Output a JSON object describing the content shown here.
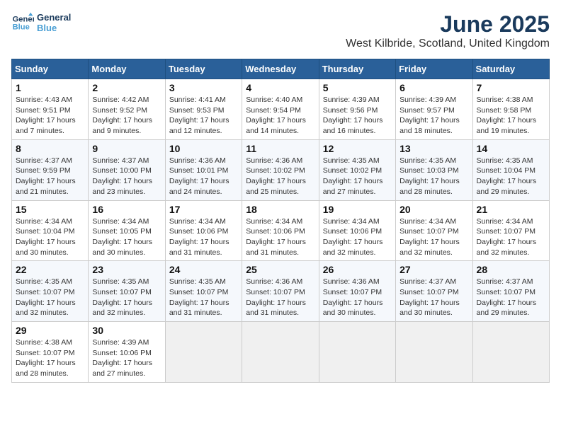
{
  "logo": {
    "line1": "General",
    "line2": "Blue"
  },
  "title": "June 2025",
  "subtitle": "West Kilbride, Scotland, United Kingdom",
  "colors": {
    "header_bg": "#2a6099",
    "accent": "#4a9fd4",
    "title_color": "#1a3a5c"
  },
  "days_of_week": [
    "Sunday",
    "Monday",
    "Tuesday",
    "Wednesday",
    "Thursday",
    "Friday",
    "Saturday"
  ],
  "weeks": [
    [
      {
        "day": "1",
        "detail": "Sunrise: 4:43 AM\nSunset: 9:51 PM\nDaylight: 17 hours\nand 7 minutes."
      },
      {
        "day": "2",
        "detail": "Sunrise: 4:42 AM\nSunset: 9:52 PM\nDaylight: 17 hours\nand 9 minutes."
      },
      {
        "day": "3",
        "detail": "Sunrise: 4:41 AM\nSunset: 9:53 PM\nDaylight: 17 hours\nand 12 minutes."
      },
      {
        "day": "4",
        "detail": "Sunrise: 4:40 AM\nSunset: 9:54 PM\nDaylight: 17 hours\nand 14 minutes."
      },
      {
        "day": "5",
        "detail": "Sunrise: 4:39 AM\nSunset: 9:56 PM\nDaylight: 17 hours\nand 16 minutes."
      },
      {
        "day": "6",
        "detail": "Sunrise: 4:39 AM\nSunset: 9:57 PM\nDaylight: 17 hours\nand 18 minutes."
      },
      {
        "day": "7",
        "detail": "Sunrise: 4:38 AM\nSunset: 9:58 PM\nDaylight: 17 hours\nand 19 minutes."
      }
    ],
    [
      {
        "day": "8",
        "detail": "Sunrise: 4:37 AM\nSunset: 9:59 PM\nDaylight: 17 hours\nand 21 minutes."
      },
      {
        "day": "9",
        "detail": "Sunrise: 4:37 AM\nSunset: 10:00 PM\nDaylight: 17 hours\nand 23 minutes."
      },
      {
        "day": "10",
        "detail": "Sunrise: 4:36 AM\nSunset: 10:01 PM\nDaylight: 17 hours\nand 24 minutes."
      },
      {
        "day": "11",
        "detail": "Sunrise: 4:36 AM\nSunset: 10:02 PM\nDaylight: 17 hours\nand 25 minutes."
      },
      {
        "day": "12",
        "detail": "Sunrise: 4:35 AM\nSunset: 10:02 PM\nDaylight: 17 hours\nand 27 minutes."
      },
      {
        "day": "13",
        "detail": "Sunrise: 4:35 AM\nSunset: 10:03 PM\nDaylight: 17 hours\nand 28 minutes."
      },
      {
        "day": "14",
        "detail": "Sunrise: 4:35 AM\nSunset: 10:04 PM\nDaylight: 17 hours\nand 29 minutes."
      }
    ],
    [
      {
        "day": "15",
        "detail": "Sunrise: 4:34 AM\nSunset: 10:04 PM\nDaylight: 17 hours\nand 30 minutes."
      },
      {
        "day": "16",
        "detail": "Sunrise: 4:34 AM\nSunset: 10:05 PM\nDaylight: 17 hours\nand 30 minutes."
      },
      {
        "day": "17",
        "detail": "Sunrise: 4:34 AM\nSunset: 10:06 PM\nDaylight: 17 hours\nand 31 minutes."
      },
      {
        "day": "18",
        "detail": "Sunrise: 4:34 AM\nSunset: 10:06 PM\nDaylight: 17 hours\nand 31 minutes."
      },
      {
        "day": "19",
        "detail": "Sunrise: 4:34 AM\nSunset: 10:06 PM\nDaylight: 17 hours\nand 32 minutes."
      },
      {
        "day": "20",
        "detail": "Sunrise: 4:34 AM\nSunset: 10:07 PM\nDaylight: 17 hours\nand 32 minutes."
      },
      {
        "day": "21",
        "detail": "Sunrise: 4:34 AM\nSunset: 10:07 PM\nDaylight: 17 hours\nand 32 minutes."
      }
    ],
    [
      {
        "day": "22",
        "detail": "Sunrise: 4:35 AM\nSunset: 10:07 PM\nDaylight: 17 hours\nand 32 minutes."
      },
      {
        "day": "23",
        "detail": "Sunrise: 4:35 AM\nSunset: 10:07 PM\nDaylight: 17 hours\nand 32 minutes."
      },
      {
        "day": "24",
        "detail": "Sunrise: 4:35 AM\nSunset: 10:07 PM\nDaylight: 17 hours\nand 31 minutes."
      },
      {
        "day": "25",
        "detail": "Sunrise: 4:36 AM\nSunset: 10:07 PM\nDaylight: 17 hours\nand 31 minutes."
      },
      {
        "day": "26",
        "detail": "Sunrise: 4:36 AM\nSunset: 10:07 PM\nDaylight: 17 hours\nand 30 minutes."
      },
      {
        "day": "27",
        "detail": "Sunrise: 4:37 AM\nSunset: 10:07 PM\nDaylight: 17 hours\nand 30 minutes."
      },
      {
        "day": "28",
        "detail": "Sunrise: 4:37 AM\nSunset: 10:07 PM\nDaylight: 17 hours\nand 29 minutes."
      }
    ],
    [
      {
        "day": "29",
        "detail": "Sunrise: 4:38 AM\nSunset: 10:07 PM\nDaylight: 17 hours\nand 28 minutes."
      },
      {
        "day": "30",
        "detail": "Sunrise: 4:39 AM\nSunset: 10:06 PM\nDaylight: 17 hours\nand 27 minutes."
      },
      null,
      null,
      null,
      null,
      null
    ]
  ]
}
